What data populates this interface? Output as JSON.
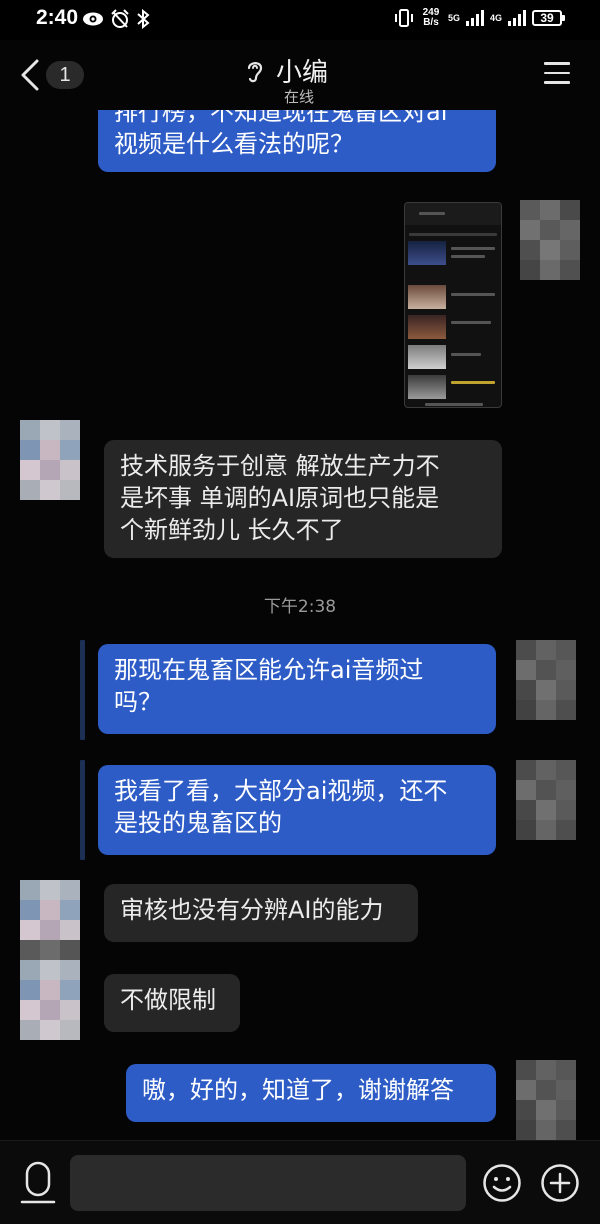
{
  "status_bar": {
    "time": "2:40",
    "net_speed_value": "249",
    "net_speed_unit": "B/s",
    "network_1": "5G",
    "network_2": "4G",
    "battery": "39"
  },
  "header": {
    "unread_count": "1",
    "contact_name": "小编",
    "contact_status": "在线"
  },
  "messages": [
    {
      "id": "m1",
      "side": "out",
      "text": "排行榜，不知道现在鬼畜区对ai\n视频是什么看法的呢？"
    },
    {
      "id": "m2",
      "side": "out",
      "type": "image",
      "description": "screenshot"
    },
    {
      "id": "m3",
      "side": "in",
      "text": "技术服务于创意 解放生产力不\n是坏事 单调的AI原词也只能是\n个新鲜劲儿 长久不了"
    },
    {
      "id": "m4",
      "side": "out",
      "text": "那现在鬼畜区能允许ai音频过\n吗？"
    },
    {
      "id": "m5",
      "side": "out",
      "text": "我看了看，大部分ai视频，还不\n是投的鬼畜区的"
    },
    {
      "id": "m6",
      "side": "in",
      "text": "审核也没有分辨AI的能力"
    },
    {
      "id": "m7",
      "side": "in",
      "text": "不做限制"
    },
    {
      "id": "m8",
      "side": "out",
      "text": "嗷，好的，知道了，谢谢解答"
    }
  ],
  "timestamp": "下午2:38",
  "input": {
    "placeholder": "",
    "value": ""
  },
  "colors": {
    "out_bubble": "#2d5cc7",
    "in_bubble": "#262626",
    "background": "#050505"
  }
}
